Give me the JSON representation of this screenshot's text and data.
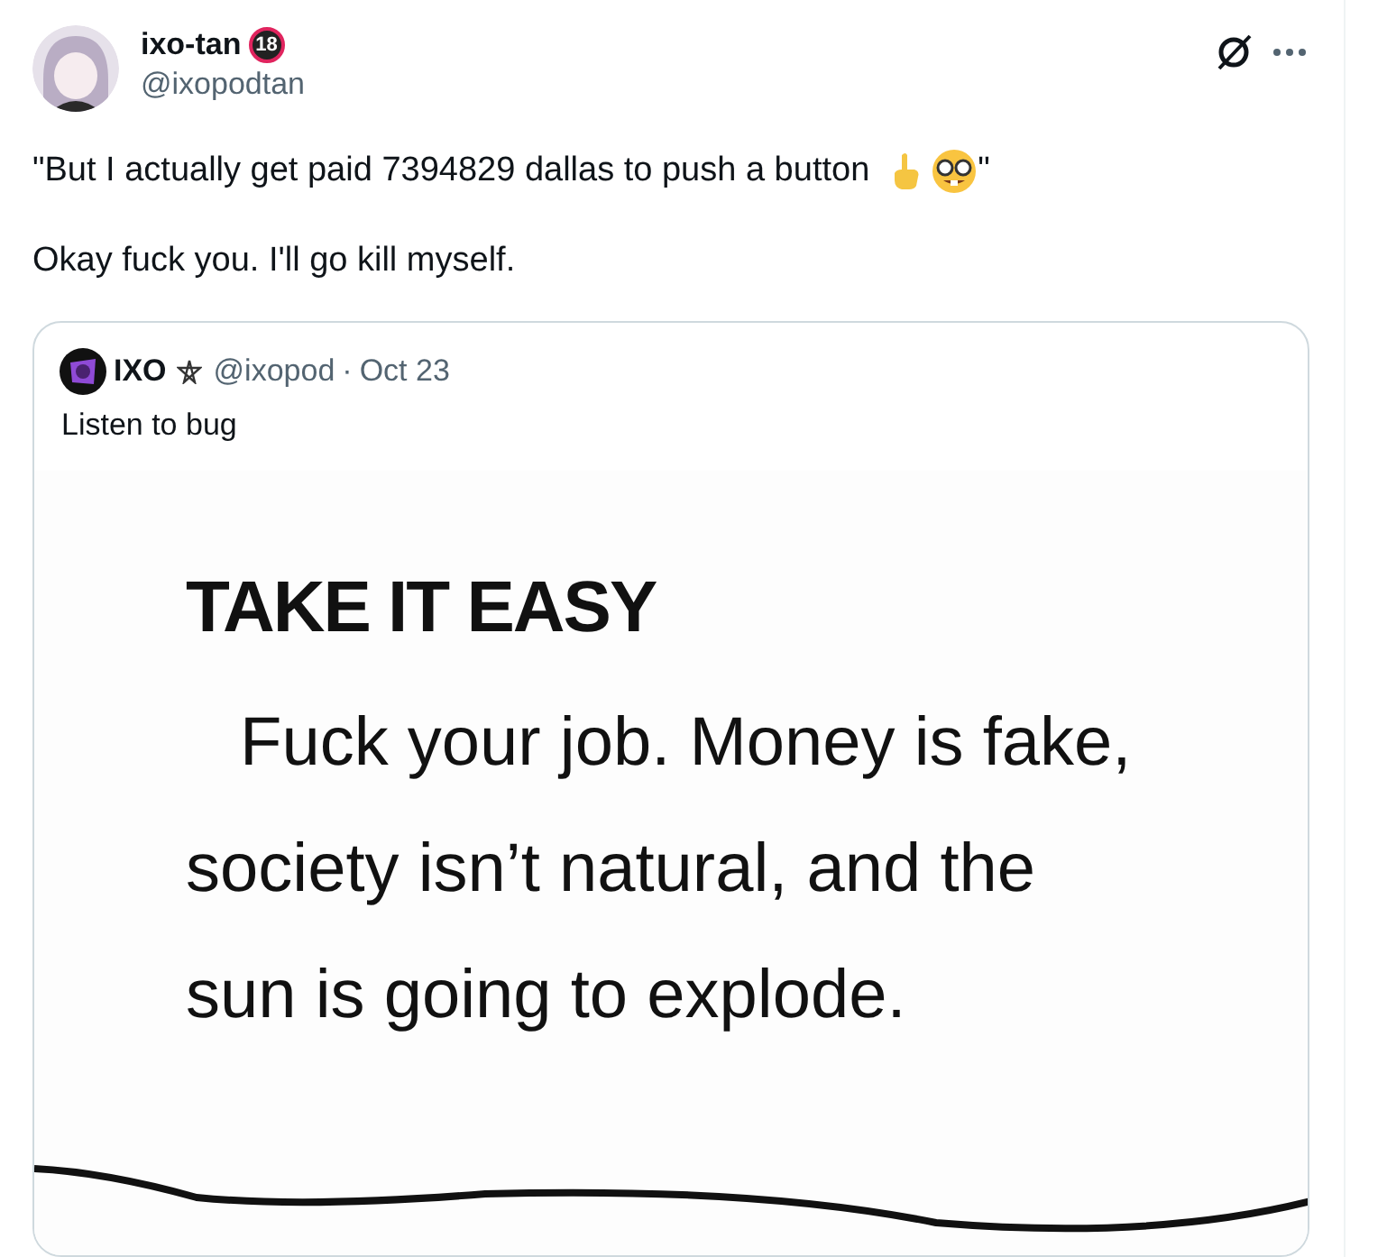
{
  "author": {
    "name": "ixo-tan",
    "badge": "18",
    "handle": "@ixopodtan"
  },
  "tweet": {
    "line_1_start": "\"But I actually get paid 7394829 dallas to push a button",
    "line_1_end": "\"",
    "line_2": "Okay fuck you. I'll go kill myself."
  },
  "quote": {
    "name": "IXO",
    "handle": "@ixopod",
    "separator": "·",
    "date": "Oct 23",
    "text": "Listen to bug",
    "image": {
      "heading": "TAKE IT EASY",
      "lines": [
        "Fuck your job. Money is fake,",
        "society isn’t natural, and the",
        "sun is going to explode."
      ]
    }
  }
}
